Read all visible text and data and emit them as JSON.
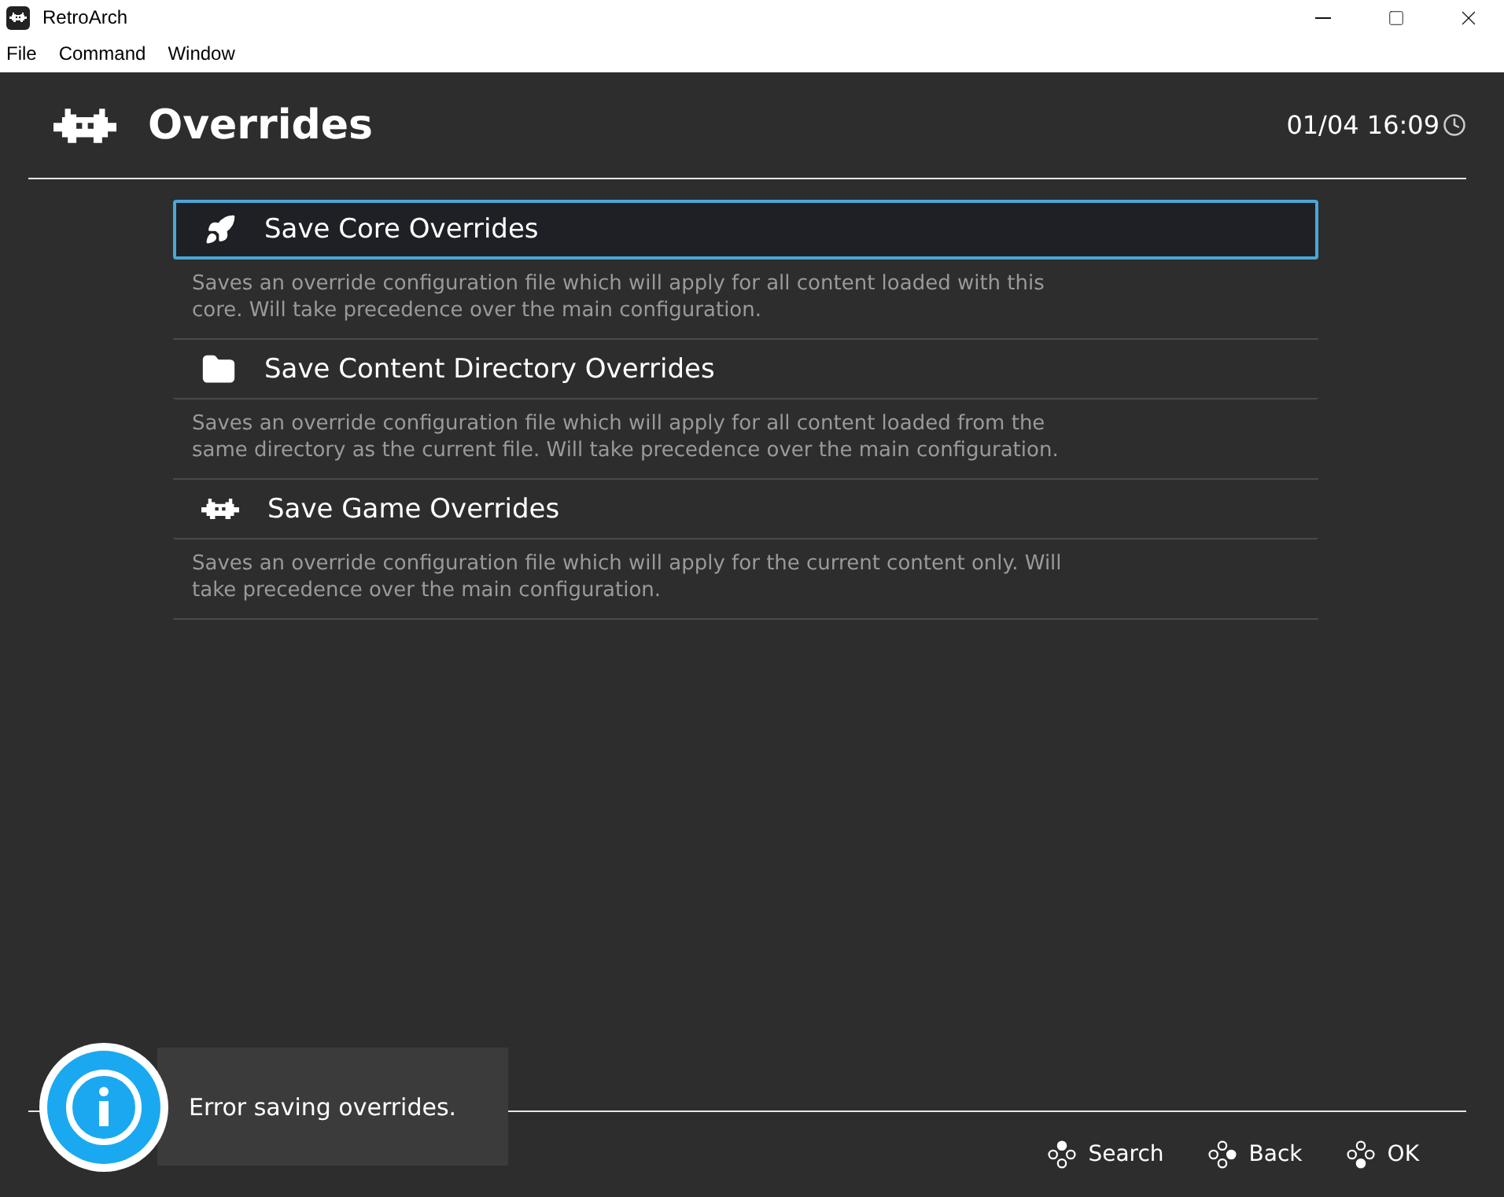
{
  "window": {
    "title": "RetroArch"
  },
  "menu": [
    "File",
    "Command",
    "Window"
  ],
  "header": {
    "title": "Overrides",
    "clock": "01/04 16:09"
  },
  "items": [
    {
      "kind": "rocket",
      "label": "Save Core Overrides",
      "selected": true,
      "description": "Saves an override configuration file which will apply for all content loaded with this core. Will take precedence over the main configuration."
    },
    {
      "kind": "folder",
      "label": "Save Content Directory Overrides",
      "selected": false,
      "description": "Saves an override configuration file which will apply for all content loaded from the same directory as the current file. Will take precedence over the main configuration."
    },
    {
      "kind": "invader",
      "label": "Save Game Overrides",
      "selected": false,
      "description": "Saves an override configuration file which will apply for the current content only. Will take precedence over the main configuration."
    }
  ],
  "footer": [
    {
      "label": "Search",
      "kind": "top"
    },
    {
      "label": "Back",
      "kind": "right"
    },
    {
      "label": "OK",
      "kind": "bottom"
    }
  ],
  "toast": {
    "message": "Error saving overrides."
  }
}
